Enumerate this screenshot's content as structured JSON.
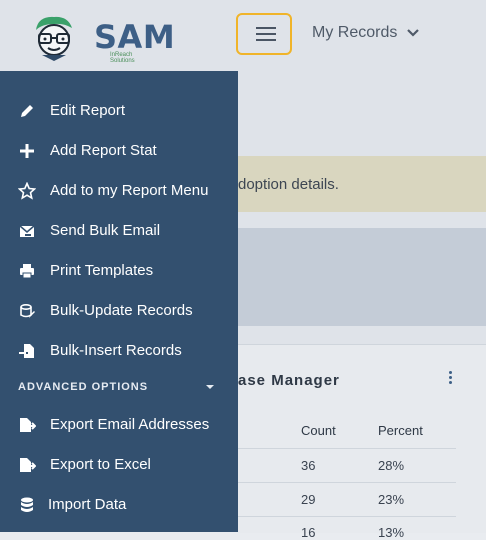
{
  "header": {
    "brand": "SAM",
    "brand_subtitle": "InReach Solutions",
    "records_menu_label": "My Records"
  },
  "background": {
    "notice_text": "doption details.",
    "card_title": "ase Manager",
    "table": {
      "columns": [
        "Count",
        "Percent"
      ],
      "rows": [
        {
          "count": "36",
          "percent": "28%"
        },
        {
          "count": "29",
          "percent": "23%"
        },
        {
          "count": "16",
          "percent": "13%"
        }
      ]
    }
  },
  "sidebar": {
    "items": [
      {
        "label": "Edit Report",
        "icon": "pencil-icon"
      },
      {
        "label": "Add Report Stat",
        "icon": "plus-icon"
      },
      {
        "label": "Add to my Report Menu",
        "icon": "star-icon"
      },
      {
        "label": "Send Bulk Email",
        "icon": "email-send-icon"
      },
      {
        "label": "Print Templates",
        "icon": "printer-icon"
      },
      {
        "label": "Bulk-Update Records",
        "icon": "database-edit-icon"
      },
      {
        "label": "Bulk-Insert Records",
        "icon": "file-import-icon"
      }
    ],
    "advanced_header": "ADVANCED OPTIONS",
    "advanced_items": [
      {
        "label": "Export Email Addresses",
        "icon": "file-export-icon"
      },
      {
        "label": "Export to Excel",
        "icon": "file-export-icon"
      },
      {
        "label": "Import Data",
        "icon": "database-icon"
      }
    ]
  },
  "colors": {
    "sidebar_bg": "#33506f",
    "brand_blue": "#3d5f86",
    "focus_outline": "#f0b42a"
  }
}
